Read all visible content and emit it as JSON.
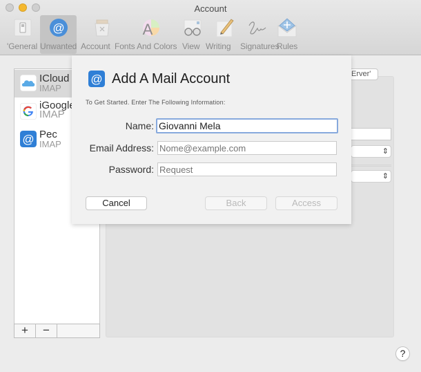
{
  "window": {
    "title": "Account"
  },
  "toolbar": {
    "items": [
      {
        "label": "'General",
        "icon": "general-switch-icon",
        "selected": false
      },
      {
        "label": "Unwanted",
        "icon": "at-sign-icon",
        "selected": true
      },
      {
        "label": "Account",
        "icon": "junk-bin-icon",
        "selected": false
      },
      {
        "label": "Fonts And Colors",
        "icon": "fonts-colors-icon",
        "selected": false
      },
      {
        "label": "View",
        "icon": "glasses-icon",
        "selected": false
      },
      {
        "label": "Writing",
        "icon": "pencil-icon",
        "selected": false
      },
      {
        "label": "Signatures",
        "icon": "signature-icon",
        "selected": false
      },
      {
        "label": "Rules",
        "icon": "rules-envelope-icon",
        "selected": false
      }
    ]
  },
  "accounts": [
    {
      "name": "ICloud",
      "type": "IMAP",
      "icon": "icloud-icon",
      "selected": true
    },
    {
      "name": "iGoogle",
      "type": "IMAP",
      "icon": "google-icon",
      "selected": false
    },
    {
      "name": "Pec",
      "type": "IMAP",
      "icon": "at-sign-icon",
      "selected": false
    }
  ],
  "list_footer": {
    "add_label": "+",
    "remove_label": "−"
  },
  "background": {
    "server_button_label": "Erver'",
    "select_arrows": "⇕"
  },
  "sheet": {
    "title": "Add A Mail Account",
    "subtitle": "To Get Started. Enter The Following Information:",
    "fields": [
      {
        "label": "Name:",
        "value": "Giovanni Mela",
        "placeholder": "",
        "focused": true
      },
      {
        "label": "Email Address:",
        "value": "",
        "placeholder": "Nome@example.com",
        "focused": false
      },
      {
        "label": "Password:",
        "value": "",
        "placeholder": "Request",
        "focused": false
      }
    ],
    "buttons": {
      "cancel": "Cancel",
      "back": "Back",
      "access": "Access"
    }
  },
  "help": {
    "label": "?"
  },
  "colors": {
    "accent_blue": "#3a82d8",
    "focus_ring": "#87a9dd",
    "traffic_yellow": "#f5b82e"
  }
}
